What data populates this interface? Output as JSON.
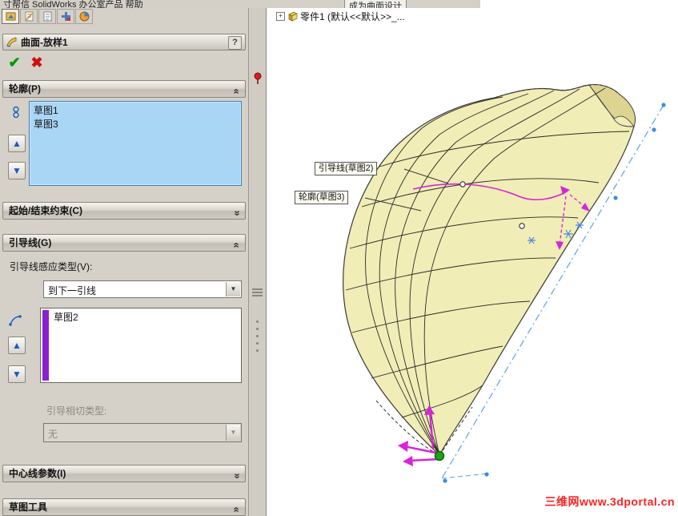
{
  "topbar": {
    "fragment_left": "寸帮信 SolidWorks 办公室产品 帮助",
    "fragment_right": "成为曲面设计"
  },
  "property_manager": {
    "title": "曲面-放样1",
    "help": "?",
    "ok_glyph": "✔",
    "cancel_glyph": "✖",
    "profiles": {
      "title": "轮廓(P)",
      "items": [
        "草图1",
        "草图3"
      ]
    },
    "start_end": {
      "title": "起始/结束约束(C)"
    },
    "guides": {
      "title": "引导线(G)",
      "influence_label": "引导线感应类型(V):",
      "influence_value": "到下一引线",
      "items": [
        "草图2"
      ],
      "tangency_label": "引导相切类型:",
      "tangency_value": "无"
    },
    "centerline": {
      "title": "中心线参数(I)"
    },
    "sketch_tools": {
      "title": "草图工具"
    }
  },
  "viewport": {
    "tree_label": "零件1 (默认<<默认>>_...",
    "callout_guide": "引导线(草图2)",
    "callout_profile": "轮廓(草图3)",
    "watermark": "三维网www.3dportal.cn"
  },
  "colors": {
    "selection_blue": "#a9d6f5",
    "guide_purple": "#8b20d0",
    "ok_green": "#009900",
    "cancel_red": "#cc1111",
    "surface_yellow": "#f1edb6",
    "construction_blue": "#68aae4",
    "magenta": "#d824d8",
    "watermark_red": "#ff2222"
  }
}
